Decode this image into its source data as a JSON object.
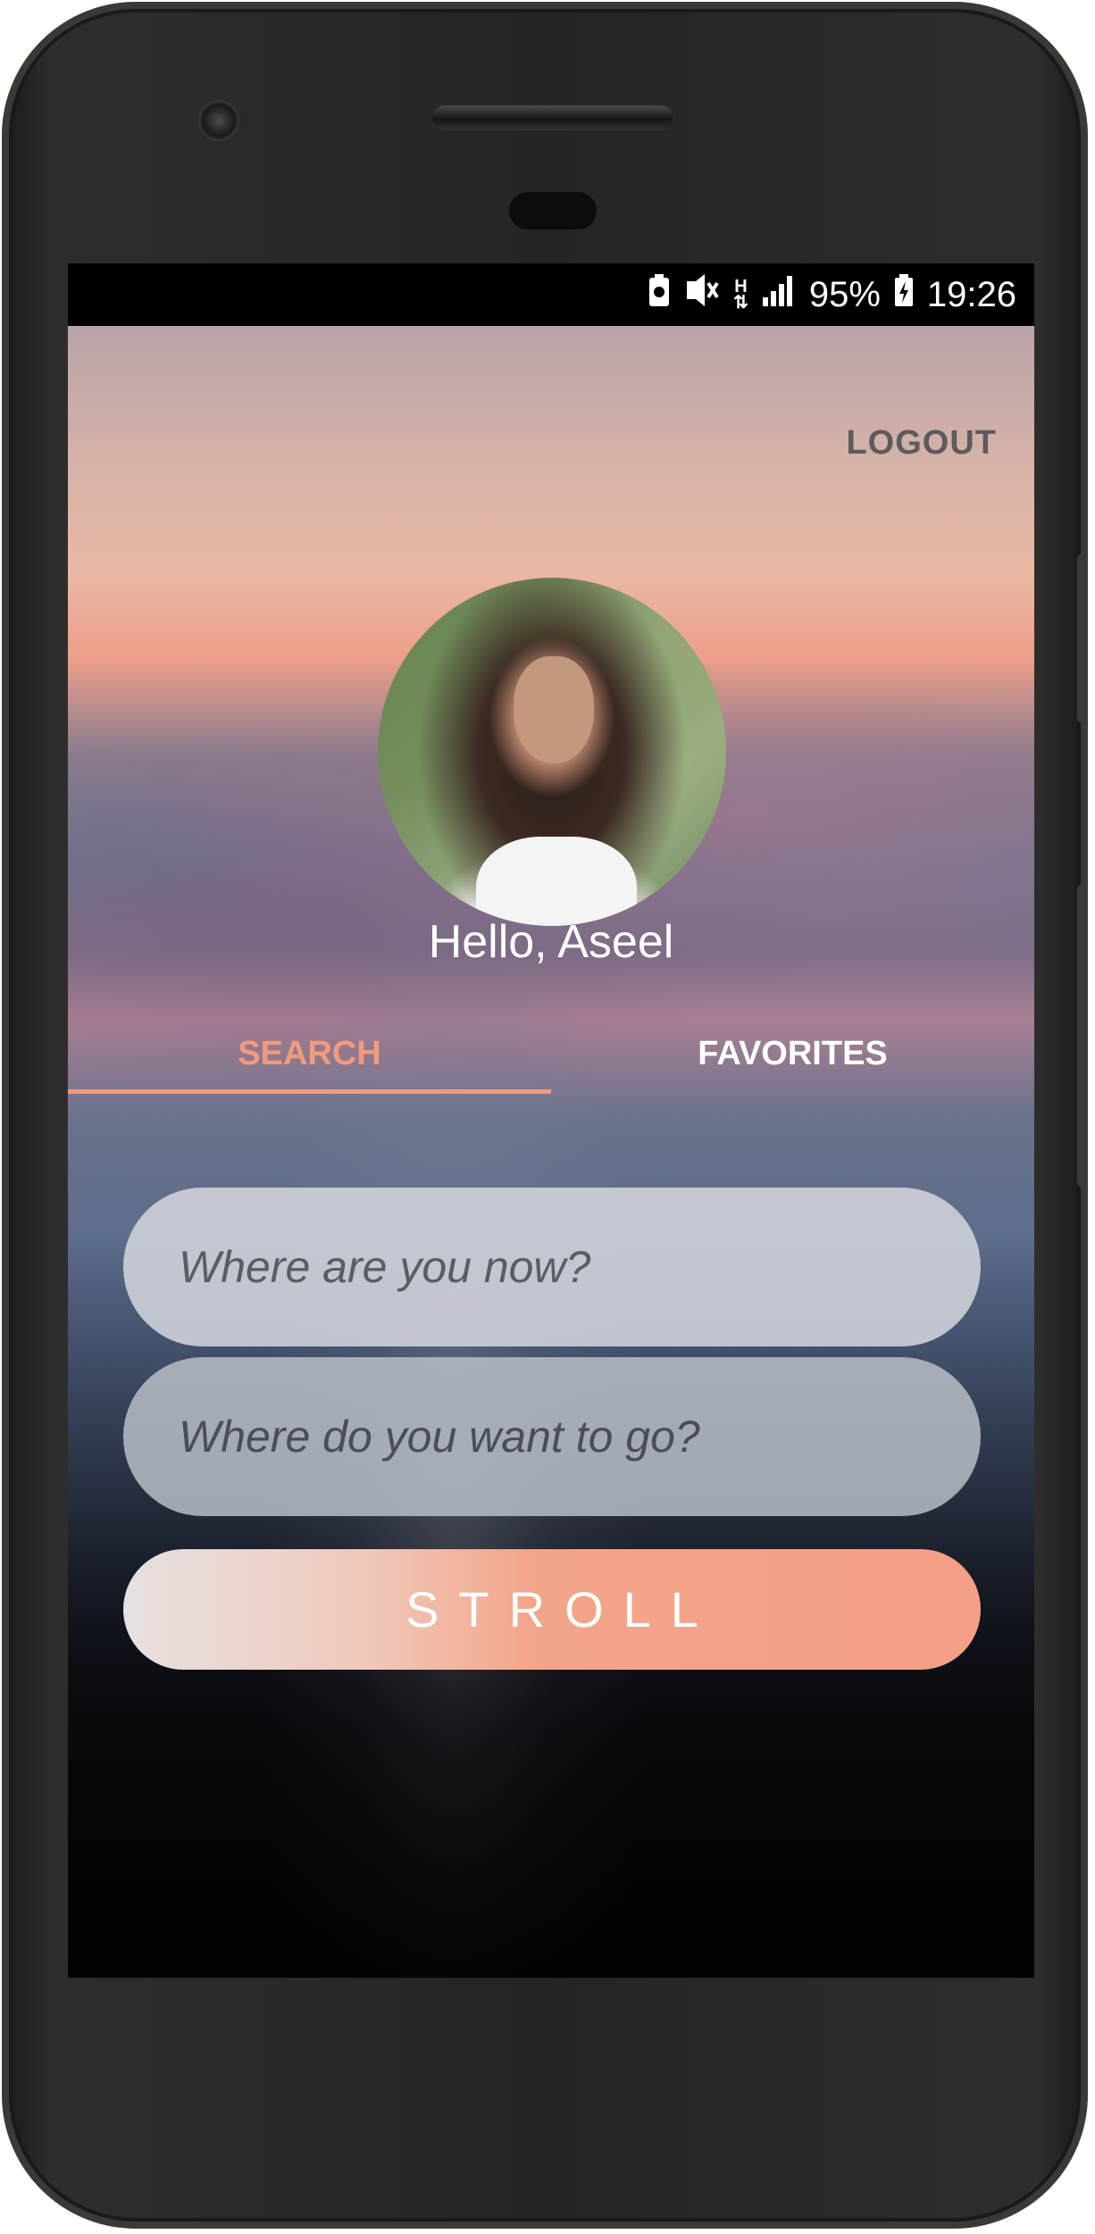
{
  "status_bar": {
    "network": "H",
    "battery": "95%",
    "time": "19:26"
  },
  "header": {
    "logout_label": "LOGOUT"
  },
  "profile": {
    "greeting": "Hello, Aseel"
  },
  "tabs": [
    {
      "label": "SEARCH",
      "active": true
    },
    {
      "label": "FAVORITES",
      "active": false
    }
  ],
  "search": {
    "from_placeholder": "Where are you now?",
    "to_placeholder": "Where do you want to go?",
    "submit_label": "STROLL"
  },
  "colors": {
    "accent": "#f39a7c",
    "logout": "#5e5a5d"
  },
  "icons": [
    "battery-saver-icon",
    "vibrate-off-icon",
    "signal-icon",
    "battery-charging-icon",
    "camera-icon",
    "speaker-icon"
  ]
}
